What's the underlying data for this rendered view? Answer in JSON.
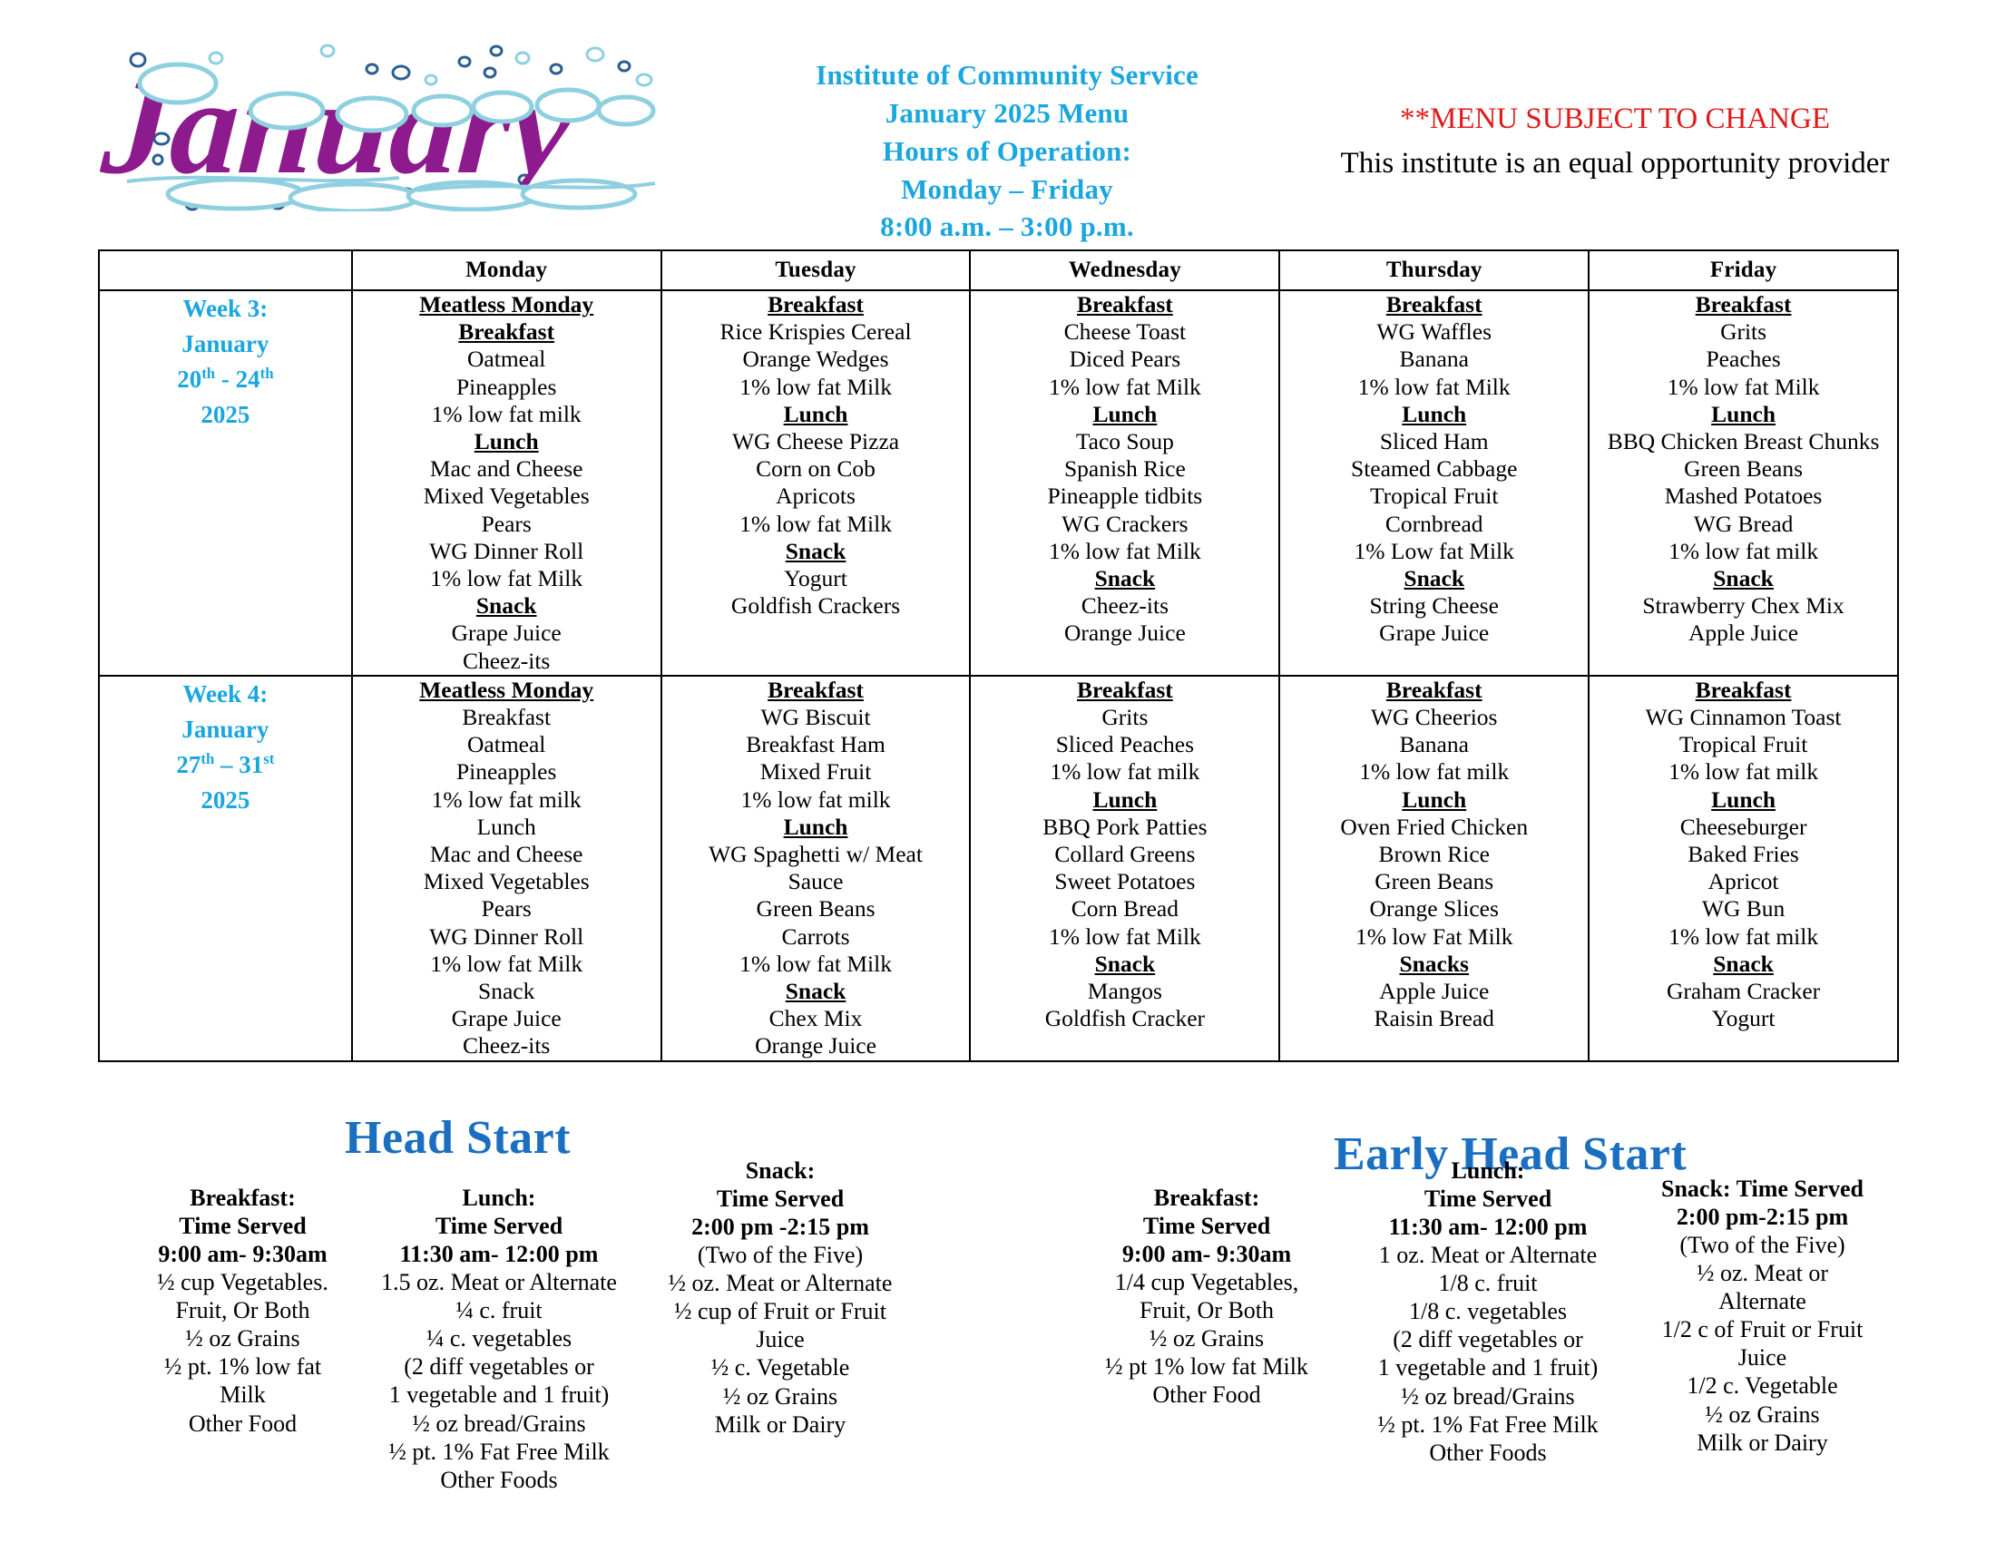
{
  "header": {
    "logo_text": "January",
    "logo_colors": {
      "letters": "#8e1b8e",
      "snow": "#7fc7dd",
      "snow_fill": "#e8f6fb"
    },
    "center": {
      "line1": "Institute of Community Service",
      "line2": "January 2025 Menu",
      "line3": "Hours of Operation:",
      "line4": "Monday – Friday",
      "line5": "8:00 a.m. – 3:00 p.m.",
      "color": "#1aa6de"
    },
    "notice": {
      "warning": "**MENU SUBJECT TO CHANGE",
      "warning_color": "#e01b1b",
      "equal_opportunity": "This institute is an equal opportunity provider"
    }
  },
  "table": {
    "columns": [
      "",
      "Monday",
      "Tuesday",
      "Wednesday",
      "Thursday",
      "Friday"
    ],
    "week_label_color": "#1aa6de",
    "rows": [
      {
        "week": {
          "name": "Week 3:",
          "month": "January",
          "dates": "20th - 24th",
          "year": "2025"
        },
        "days": [
          {
            "day": "Monday",
            "blocks": [
              {
                "heading": "Meatless Monday",
                "heading_style": "bold-underline",
                "items": []
              },
              {
                "heading": "Breakfast",
                "heading_style": "bold-underline",
                "items": [
                  "Oatmeal",
                  "Pineapples",
                  "1% low fat milk"
                ]
              },
              {
                "heading": "Lunch",
                "heading_style": "bold-underline",
                "items": [
                  "Mac and Cheese",
                  "Mixed Vegetables",
                  "Pears",
                  "WG Dinner Roll",
                  "1% low fat Milk"
                ]
              },
              {
                "heading": "Snack",
                "heading_style": "bold-underline",
                "items": [
                  "Grape Juice",
                  "Cheez-its"
                ]
              }
            ]
          },
          {
            "day": "Tuesday",
            "blocks": [
              {
                "heading": "Breakfast",
                "heading_style": "bold-underline",
                "items": [
                  "Rice Krispies Cereal",
                  "Orange Wedges",
                  "1% low fat Milk"
                ]
              },
              {
                "heading": "Lunch",
                "heading_style": "bold-underline",
                "items": [
                  "WG Cheese Pizza",
                  "Corn on Cob",
                  "Apricots",
                  "1% low fat Milk"
                ]
              },
              {
                "heading": "Snack",
                "heading_style": "bold-underline",
                "items": [
                  "Yogurt",
                  "Goldfish Crackers"
                ]
              }
            ]
          },
          {
            "day": "Wednesday",
            "blocks": [
              {
                "heading": "Breakfast",
                "heading_style": "bold-underline",
                "items": [
                  "Cheese Toast",
                  "Diced Pears",
                  "1% low fat Milk"
                ]
              },
              {
                "heading": "Lunch",
                "heading_style": "bold-underline",
                "items": [
                  "Taco Soup",
                  "Spanish Rice",
                  "Pineapple tidbits",
                  "WG Crackers",
                  "1% low fat Milk"
                ]
              },
              {
                "heading": "Snack",
                "heading_style": "bold-underline",
                "items": [
                  "Cheez-its",
                  "Orange Juice"
                ]
              }
            ]
          },
          {
            "day": "Thursday",
            "blocks": [
              {
                "heading": "Breakfast",
                "heading_style": "bold-underline",
                "items": [
                  "WG Waffles",
                  "Banana",
                  "1% low fat Milk"
                ]
              },
              {
                "heading": "Lunch",
                "heading_style": "bold-underline",
                "items": [
                  "Sliced Ham",
                  "Steamed Cabbage",
                  "Tropical Fruit",
                  "Cornbread",
                  "1% Low fat Milk"
                ]
              },
              {
                "heading": "Snack",
                "heading_style": "bold-underline",
                "items": [
                  "String Cheese",
                  "Grape Juice"
                ]
              }
            ]
          },
          {
            "day": "Friday",
            "blocks": [
              {
                "heading": "Breakfast",
                "heading_style": "bold-underline",
                "items": [
                  "Grits",
                  "Peaches",
                  "1% low fat Milk"
                ]
              },
              {
                "heading": "Lunch",
                "heading_style": "bold-underline",
                "items": [
                  "BBQ Chicken Breast Chunks",
                  "Green Beans",
                  "Mashed Potatoes",
                  "WG Bread",
                  "1% low fat milk"
                ]
              },
              {
                "heading": "Snack",
                "heading_style": "bold-underline",
                "items": [
                  "Strawberry Chex Mix",
                  "Apple Juice"
                ]
              }
            ]
          }
        ]
      },
      {
        "week": {
          "name": "Week 4:",
          "month": "January",
          "dates": "27th – 31st",
          "year": "2025"
        },
        "days": [
          {
            "day": "Monday",
            "blocks": [
              {
                "heading": "Meatless Monday",
                "heading_style": "bold-underline",
                "items": []
              },
              {
                "heading": "Breakfast",
                "heading_style": "plain",
                "items": [
                  "Oatmeal",
                  "Pineapples",
                  "1% low fat milk"
                ]
              },
              {
                "heading": "Lunch",
                "heading_style": "plain",
                "items": [
                  "Mac and Cheese",
                  "Mixed Vegetables",
                  "Pears",
                  "WG Dinner Roll",
                  "1% low fat Milk"
                ]
              },
              {
                "heading": "Snack",
                "heading_style": "plain",
                "items": [
                  "Grape Juice",
                  "Cheez-its"
                ]
              }
            ]
          },
          {
            "day": "Tuesday",
            "blocks": [
              {
                "heading": "Breakfast",
                "heading_style": "bold-underline",
                "items": [
                  "WG Biscuit",
                  "Breakfast Ham",
                  "Mixed Fruit",
                  "1% low fat milk"
                ]
              },
              {
                "heading": "Lunch",
                "heading_style": "bold-underline",
                "items": [
                  "WG Spaghetti w/ Meat",
                  "Sauce",
                  "Green Beans",
                  "Carrots",
                  "1% low fat Milk"
                ]
              },
              {
                "heading": "Snack",
                "heading_style": "bold-underline",
                "items": [
                  "Chex Mix",
                  "Orange Juice"
                ]
              }
            ]
          },
          {
            "day": "Wednesday",
            "blocks": [
              {
                "heading": "Breakfast",
                "heading_style": "bold-underline",
                "items": [
                  "Grits",
                  "Sliced Peaches",
                  "1% low fat milk"
                ]
              },
              {
                "heading": "Lunch",
                "heading_style": "bold-underline",
                "items": [
                  "BBQ Pork Patties",
                  "Collard Greens",
                  "Sweet Potatoes",
                  "Corn Bread",
                  "1% low fat Milk"
                ]
              },
              {
                "heading": "Snack",
                "heading_style": "bold-underline",
                "items": [
                  "Mangos",
                  "Goldfish Cracker"
                ]
              }
            ]
          },
          {
            "day": "Thursday",
            "blocks": [
              {
                "heading": "Breakfast",
                "heading_style": "bold-underline",
                "items": [
                  "WG Cheerios",
                  "Banana",
                  "1% low fat milk"
                ]
              },
              {
                "heading": "Lunch",
                "heading_style": "bold-underline",
                "items": [
                  "Oven Fried Chicken",
                  "Brown Rice",
                  "Green Beans",
                  "Orange Slices",
                  "1% low Fat Milk"
                ]
              },
              {
                "heading": "Snacks",
                "heading_style": "bold-underline",
                "items": [
                  "Apple Juice",
                  "Raisin Bread"
                ]
              }
            ]
          },
          {
            "day": "Friday",
            "blocks": [
              {
                "heading": "Breakfast",
                "heading_style": "bold-underline",
                "items": [
                  "WG Cinnamon Toast",
                  "Tropical Fruit",
                  "1% low fat milk"
                ]
              },
              {
                "heading": "Lunch",
                "heading_style": "bold-underline",
                "items": [
                  "Cheeseburger",
                  "Baked Fries",
                  "Apricot",
                  "WG Bun",
                  "1% low fat milk"
                ]
              },
              {
                "heading": "Snack",
                "heading_style": "bold-underline",
                "items": [
                  "Graham Cracker",
                  "Yogurt"
                ]
              }
            ]
          }
        ]
      }
    ]
  },
  "footer": {
    "head_start": {
      "title": "Head Start",
      "title_color": "#1b6fc0",
      "breakfast": {
        "bold": [
          "Breakfast:",
          "Time Served",
          "9:00 am- 9:30am"
        ],
        "normal": [
          "½ cup Vegetables.",
          "Fruit, Or Both",
          "½ oz Grains",
          "½ pt. 1% low fat",
          "Milk",
          "Other Food"
        ]
      },
      "lunch": {
        "bold": [
          "Lunch:",
          "Time Served",
          "11:30 am- 12:00 pm"
        ],
        "normal": [
          "1.5 oz. Meat or Alternate",
          "¼ c. fruit",
          "¼ c. vegetables",
          "(2 diff vegetables or",
          "1 vegetable and 1 fruit)",
          "½ oz bread/Grains",
          "½ pt. 1% Fat Free Milk",
          "Other Foods"
        ]
      },
      "snack": {
        "bold": [
          "Snack:",
          "Time Served",
          "2:00 pm -2:15 pm"
        ],
        "normal": [
          "(Two of the Five)",
          "½ oz. Meat or Alternate",
          "½ cup of Fruit or Fruit",
          "Juice",
          "½ c. Vegetable",
          "½ oz Grains",
          "Milk or Dairy"
        ]
      }
    },
    "early_head_start": {
      "title": "Early Head Start",
      "title_color": "#1b6fc0",
      "breakfast": {
        "bold": [
          "Breakfast:",
          "Time Served",
          "9:00 am- 9:30am"
        ],
        "normal": [
          "1/4 cup Vegetables,",
          "Fruit, Or Both",
          "½ oz Grains",
          "½ pt 1% low fat Milk",
          "Other Food"
        ]
      },
      "lunch": {
        "bold": [
          "Lunch:",
          "Time Served",
          "11:30 am- 12:00 pm"
        ],
        "normal": [
          "1 oz. Meat or Alternate",
          "1/8 c. fruit",
          "1/8 c. vegetables",
          "(2 diff vegetables or",
          "1 vegetable and 1 fruit)",
          "½ oz bread/Grains",
          "½ pt. 1% Fat Free Milk",
          "Other Foods"
        ]
      },
      "snack": {
        "bold": [
          "Snack: Time Served",
          "2:00 pm-2:15 pm"
        ],
        "normal": [
          "(Two of the Five)",
          "½ oz. Meat or",
          "Alternate",
          "1/2 c of Fruit or Fruit",
          "Juice",
          "1/2 c. Vegetable",
          "½ oz Grains",
          "Milk or Dairy"
        ]
      }
    }
  }
}
